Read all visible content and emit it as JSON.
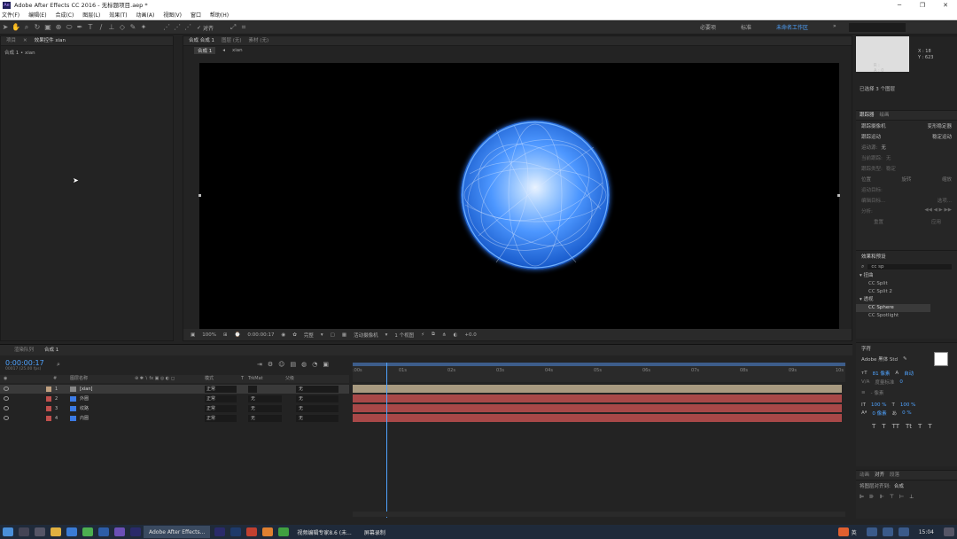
{
  "window": {
    "title": "Adobe After Effects CC 2016 - 无标题项目.aep *",
    "logo": "Ae"
  },
  "menu": [
    "文件(F)",
    "编辑(E)",
    "合成(C)",
    "图层(L)",
    "效果(T)",
    "动画(A)",
    "视图(V)",
    "窗口",
    "帮助(H)"
  ],
  "toolbar": {
    "snap_label": "对齐",
    "workspaces": [
      "必要项",
      "标准",
      "未命名工作区"
    ],
    "search_placeholder": ""
  },
  "project_panel": {
    "tabs": [
      "项目",
      "效果控件 xian"
    ],
    "breadcrumb": "合成 1 • xian"
  },
  "viewer": {
    "tabs": [
      "合成 合成 1",
      "图层 (无)",
      "素材 (无)"
    ],
    "comp_tab": "合成 1",
    "layer_tab": "xian",
    "zoom": "100%",
    "timecode": "0:00:00:17",
    "resolution": "完整",
    "camera": "活动摄像机",
    "views": "1 个视图",
    "exposure": "+0.0"
  },
  "info_panel": {
    "lines": [
      "R : ",
      "G : ",
      "B : ",
      "A : 0"
    ],
    "xy": [
      "X : 18",
      "Y : 623"
    ],
    "selection": "已选择 3 个图层"
  },
  "tracker_panel": {
    "tabs": [
      "跟踪器",
      "绘画"
    ],
    "buttons": [
      "跟踪摄像机",
      "变形稳定器",
      "跟踪运动",
      "稳定运动"
    ],
    "fields": [
      {
        "label": "运动源:",
        "value": "无"
      },
      {
        "label": "当前跟踪:",
        "value": "无"
      },
      {
        "label": "跟踪类型:",
        "value": "稳定"
      }
    ],
    "checks": [
      "位置",
      "旋转",
      "缩放"
    ],
    "links": [
      "运动目标:",
      "编辑目标...",
      "选项..."
    ],
    "analyze": "分析:",
    "footer": [
      "重置",
      "应用"
    ]
  },
  "effects_panel": {
    "title": "效果和预设",
    "search": "cc sp",
    "categories": [
      {
        "name": "扭曲",
        "items": [
          "CC Split",
          "CC Split 2"
        ]
      },
      {
        "name": "透视",
        "items": [
          "CC Sphere",
          "CC Spotlight"
        ]
      }
    ]
  },
  "char_panel": {
    "title": "字符",
    "font": "Adobe 黑体 Std",
    "size": "81 像素",
    "leading": "自动",
    "kerning": "度量标准",
    "tracking": "0",
    "stroke": "- 像素",
    "vscale": "100 %",
    "hscale": "100 %",
    "baseline": "0 像素",
    "tsume": "0 %",
    "styles": [
      "T",
      "T",
      "TT",
      "Tt",
      "T",
      "T",
      "T"
    ]
  },
  "align_panel": {
    "tabs": [
      "动画",
      "对齐",
      "段落"
    ],
    "label": "将图层对齐到:",
    "target": "合成"
  },
  "timeline": {
    "tabs": [
      "渲染队列",
      "合成 1"
    ],
    "timecode": "0:00:00:17",
    "fps": "00017 (25.00 fps)",
    "columns": [
      "图层名称",
      "模式",
      "T",
      "TrkMat",
      "父级"
    ],
    "ticks": [
      ":00s",
      "01s",
      "02s",
      "03s",
      "04s",
      "05s",
      "06s",
      "07s",
      "08s",
      "09s",
      "10s"
    ],
    "layers": [
      {
        "num": "1",
        "name": "[xian]",
        "mode": "正常",
        "trk": "",
        "parent": "无"
      },
      {
        "num": "2",
        "name": "外圈",
        "mode": "正常",
        "trk": "无",
        "parent": "无"
      },
      {
        "num": "3",
        "name": "纹路",
        "mode": "正常",
        "trk": "无",
        "parent": "无"
      },
      {
        "num": "4",
        "name": "内圈",
        "mode": "正常",
        "trk": "无",
        "parent": "无"
      }
    ]
  },
  "taskbar": {
    "apps": [
      "Adobe After Effects...",
      "视频编辑专家8.6 (未...",
      "屏幕录制"
    ],
    "time": "15:04",
    "ime": "英"
  }
}
